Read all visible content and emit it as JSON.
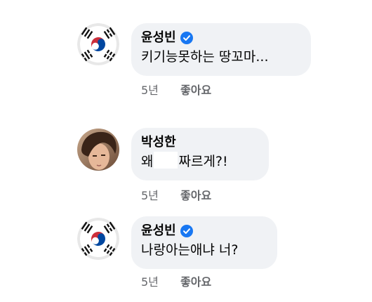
{
  "comments": [
    {
      "author": "윤성빈",
      "verified": true,
      "avatar_icon": "south-korea-flag-icon",
      "text": "키기능못하는 땅꼬마...",
      "time": "5년",
      "like_label": "좋아요"
    },
    {
      "author": "박성한",
      "verified": false,
      "avatar_icon": "profile-photo",
      "text_before": "왜",
      "text_after": "짜르게?!",
      "time": "5년",
      "like_label": "좋아요"
    },
    {
      "author": "윤성빈",
      "verified": true,
      "avatar_icon": "south-korea-flag-icon",
      "text": "나랑아는애냐 너?",
      "time": "5년",
      "like_label": "좋아요"
    }
  ],
  "colors": {
    "bubble": "#f0f2f5",
    "verified_badge": "#1877f2",
    "meta_text": "#65676b"
  }
}
